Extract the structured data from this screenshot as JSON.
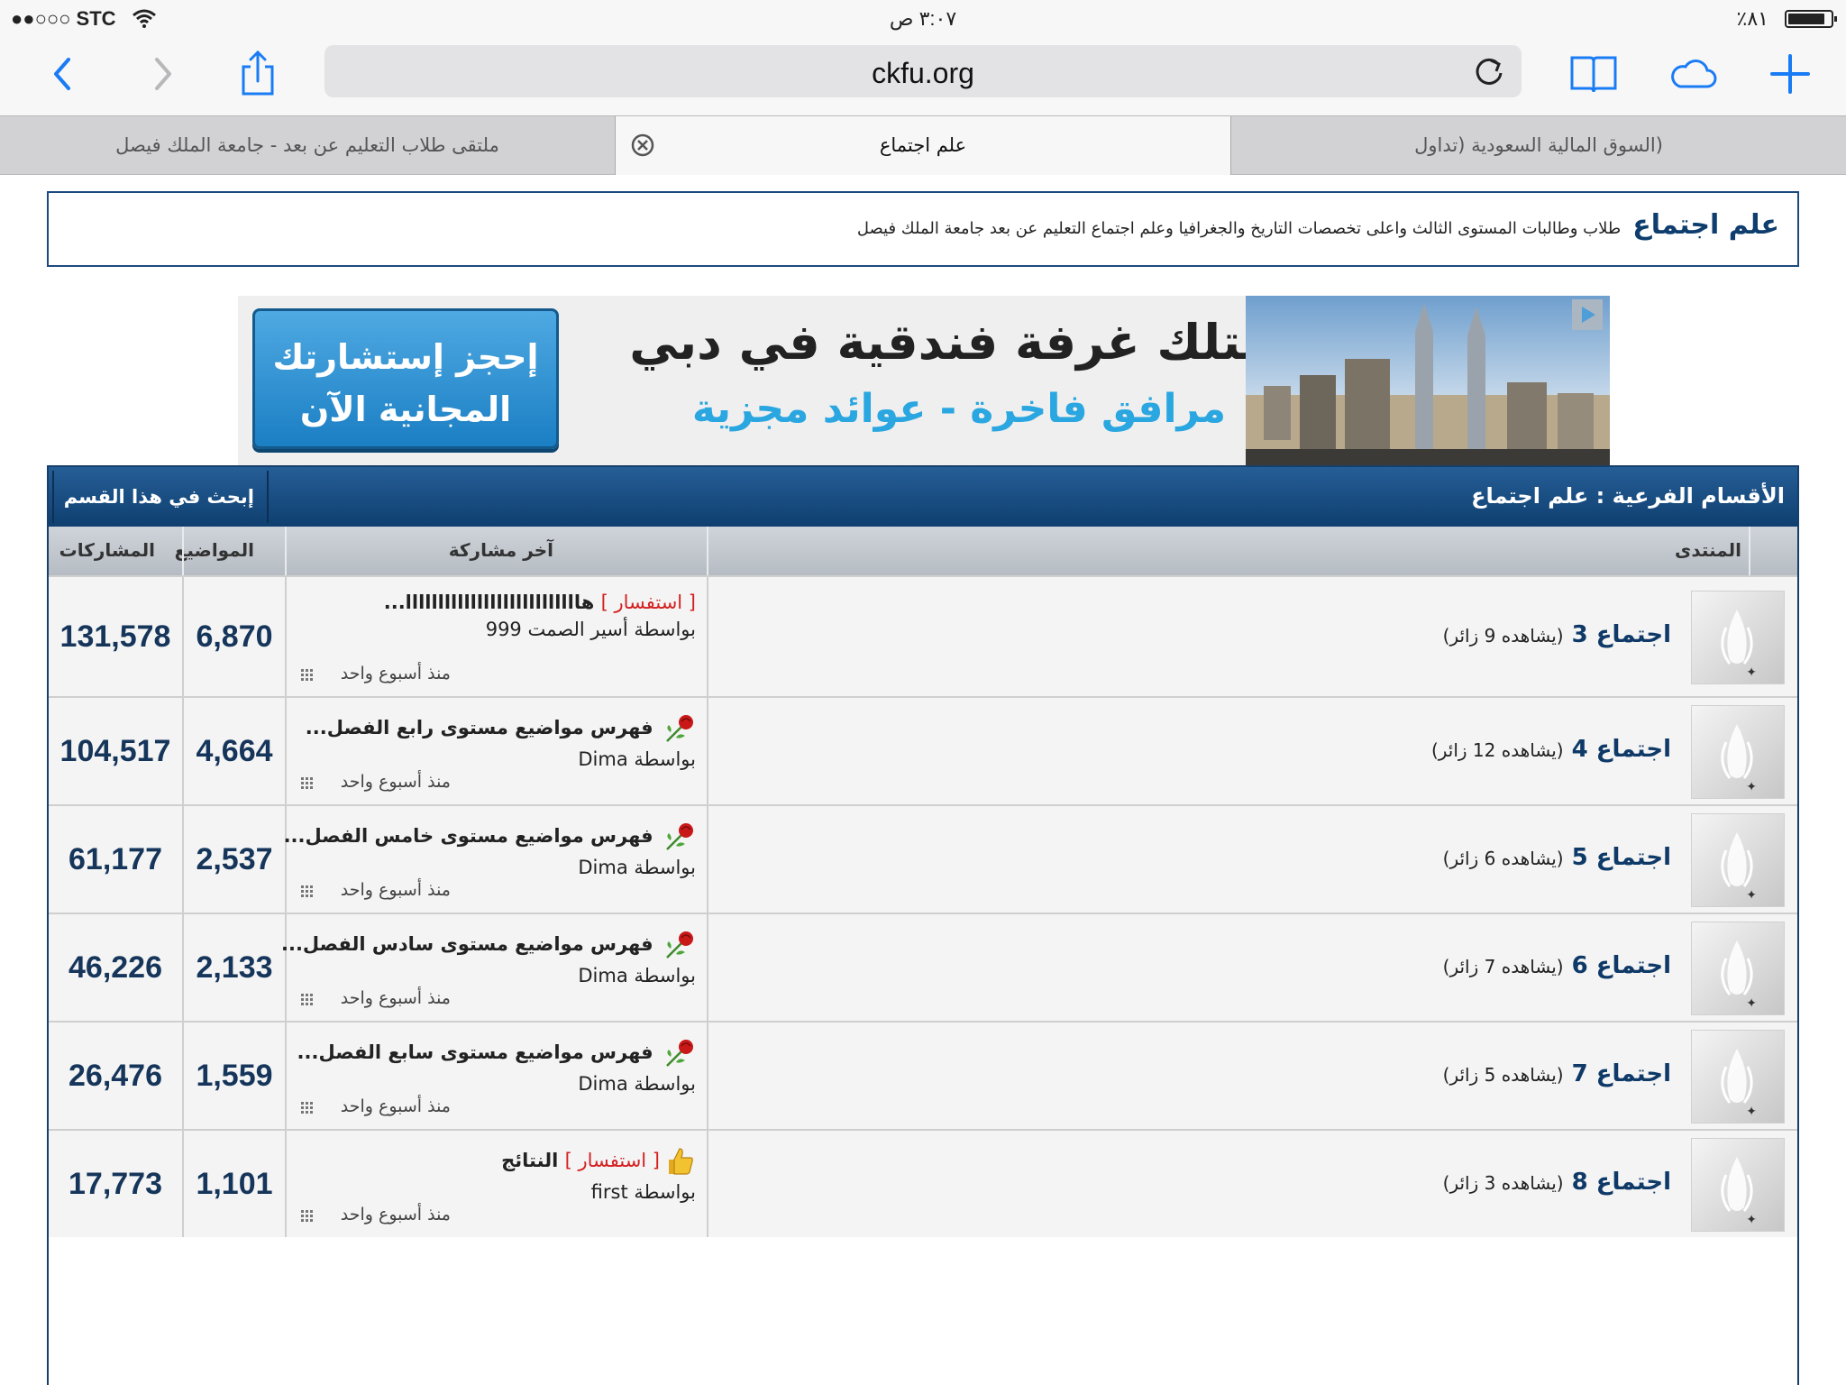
{
  "status_bar": {
    "carrier": "●●○○○ STC",
    "time": "٣:٠٧ ص",
    "battery": "٪٨١"
  },
  "browser": {
    "url": "ckfu.org",
    "tabs": [
      {
        "label": "ملتقى طلاب التعليم عن بعد - جامعة الملك فيصل",
        "active": false
      },
      {
        "label": "علم اجتماع",
        "active": true
      },
      {
        "label": "(السوق المالية السعودية (تداول",
        "active": false
      }
    ]
  },
  "header": {
    "title": "علم اجتماع",
    "description": "طلاب وطالبات المستوى الثالث واعلى تخصصات التاريخ والجغرافيا وعلم اجتماع التعليم عن بعد جامعة الملك فيصل"
  },
  "ad": {
    "cta_line1": "إحجز إستشارتك",
    "cta_line2": "المجانية الآن",
    "headline": "امتلك غرفة فندقية في دبي",
    "subline": "مرافق فاخرة - عوائد مجزية"
  },
  "forum": {
    "title": "الأقسام الفرعية : علم اجتماع",
    "search_label": "إبحث في هذا القسم",
    "columns": {
      "forum": "المنتدى",
      "last_post": "آخر مشاركة",
      "topics": "المواضيع",
      "posts": "المشاركات"
    },
    "rows": [
      {
        "name": "اجتماع 3",
        "viewers": "(يشاهده 9 زائر)",
        "last_prefix": "[ استفسار ]",
        "last_title": "هااااااااااااااااااااااااااا...",
        "last_by": "بواسطة أسير الصمت 999",
        "last_time": "منذ أسبوع واحد",
        "topics": "6,870",
        "posts": "131,578",
        "icon": "none"
      },
      {
        "name": "اجتماع 4",
        "viewers": "(يشاهده 12 زائر)",
        "last_prefix": "",
        "last_title": "فهرس مواضيع مستوى رابع الفصل...",
        "last_by": "بواسطة Dima",
        "last_time": "منذ أسبوع واحد",
        "topics": "4,664",
        "posts": "104,517",
        "icon": "rose"
      },
      {
        "name": "اجتماع 5",
        "viewers": "(يشاهده 6 زائر)",
        "last_prefix": "",
        "last_title": "فهرس مواضيع مستوى خامس الفصل...",
        "last_by": "بواسطة Dima",
        "last_time": "منذ أسبوع واحد",
        "topics": "2,537",
        "posts": "61,177",
        "icon": "rose"
      },
      {
        "name": "اجتماع 6",
        "viewers": "(يشاهده 7 زائر)",
        "last_prefix": "",
        "last_title": "فهرس مواضيع مستوى سادس الفصل...",
        "last_by": "بواسطة Dima",
        "last_time": "منذ أسبوع واحد",
        "topics": "2,133",
        "posts": "46,226",
        "icon": "rose"
      },
      {
        "name": "اجتماع 7",
        "viewers": "(يشاهده 5 زائر)",
        "last_prefix": "",
        "last_title": "فهرس مواضيع مستوى سابع الفصل...",
        "last_by": "بواسطة Dima",
        "last_time": "منذ أسبوع واحد",
        "topics": "1,559",
        "posts": "26,476",
        "icon": "rose"
      },
      {
        "name": "اجتماع 8",
        "viewers": "(يشاهده 3 زائر)",
        "last_prefix": "[ استفسار ]",
        "last_title": "النتائج",
        "last_by": "بواسطة first",
        "last_time": "منذ أسبوع واحد",
        "topics": "1,101",
        "posts": "17,773",
        "icon": "thumb"
      }
    ]
  },
  "colors": {
    "header_blue": "#0f3f70",
    "link_blue": "#0f3a68",
    "prefix_red": "#d42020",
    "ad_blue": "#2aa6e0"
  }
}
